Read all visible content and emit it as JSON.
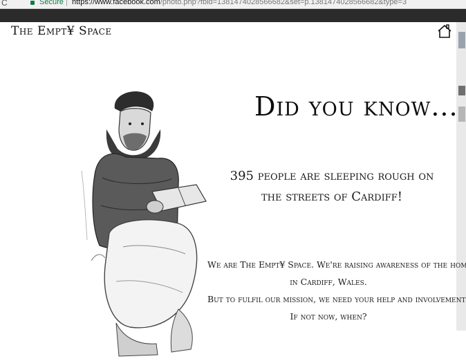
{
  "browser": {
    "reload_glyph": "C",
    "secure_label": "Secure",
    "separator": "|",
    "url_host": "https://www.facebook.com",
    "url_rest": "/photo.php?fbid=1381474028566682&set=p.1381474028566682&type=3"
  },
  "poster": {
    "brand": "The Empt¥ Space",
    "headline": "Did you know...",
    "stat_line1": "395 people are sleeping rough on",
    "stat_line2": "the streets of Cardiff!",
    "mission_line1": "We are The Empt¥ Space. We're raising awareness of the homeless",
    "mission_line2": "in Cardiff, Wales.",
    "mission_line3": "But to fulfil our mission, we need your help and involvement.",
    "mission_line4": "If not now, when?"
  },
  "colors": {
    "secure_green": "#0b8043",
    "ink": "#111111",
    "viewer_dark": "#2b2b2b"
  },
  "icons": [
    "home-icon",
    "lock-icon",
    "reload-icon"
  ]
}
